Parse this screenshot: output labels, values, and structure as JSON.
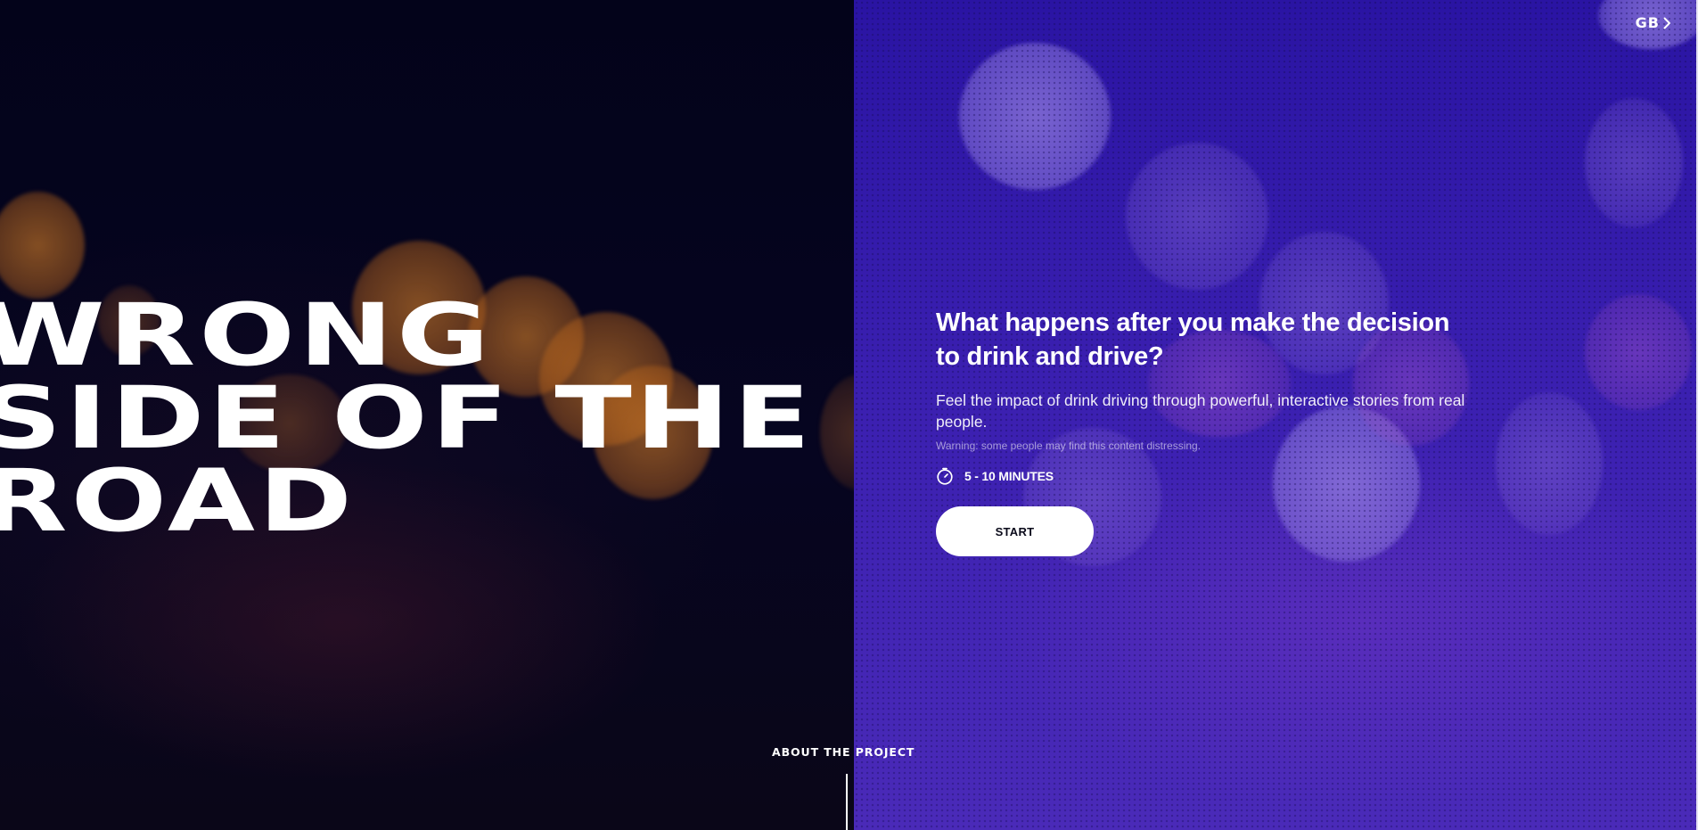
{
  "hero": {
    "title_lines": [
      "WRONG",
      "SIDE OF THE",
      "ROAD"
    ]
  },
  "header": {
    "locale_label": "GB",
    "locale_icon": "chevron-right-icon"
  },
  "intro": {
    "heading": "What happens after you make the decision to drink and drive?",
    "description": "Feel the impact of drink driving through powerful, interactive stories from real people.",
    "warning": "Warning: some people may find this content distressing.",
    "duration_icon": "timer-icon",
    "duration": "5 - 10 MINUTES",
    "start_label": "START"
  },
  "footer": {
    "about_label": "ABOUT THE PROJECT"
  },
  "colors": {
    "left_background": "#03031a",
    "right_background": "#3a1fb0",
    "button_background": "#ffffff",
    "text": "#ffffff"
  }
}
